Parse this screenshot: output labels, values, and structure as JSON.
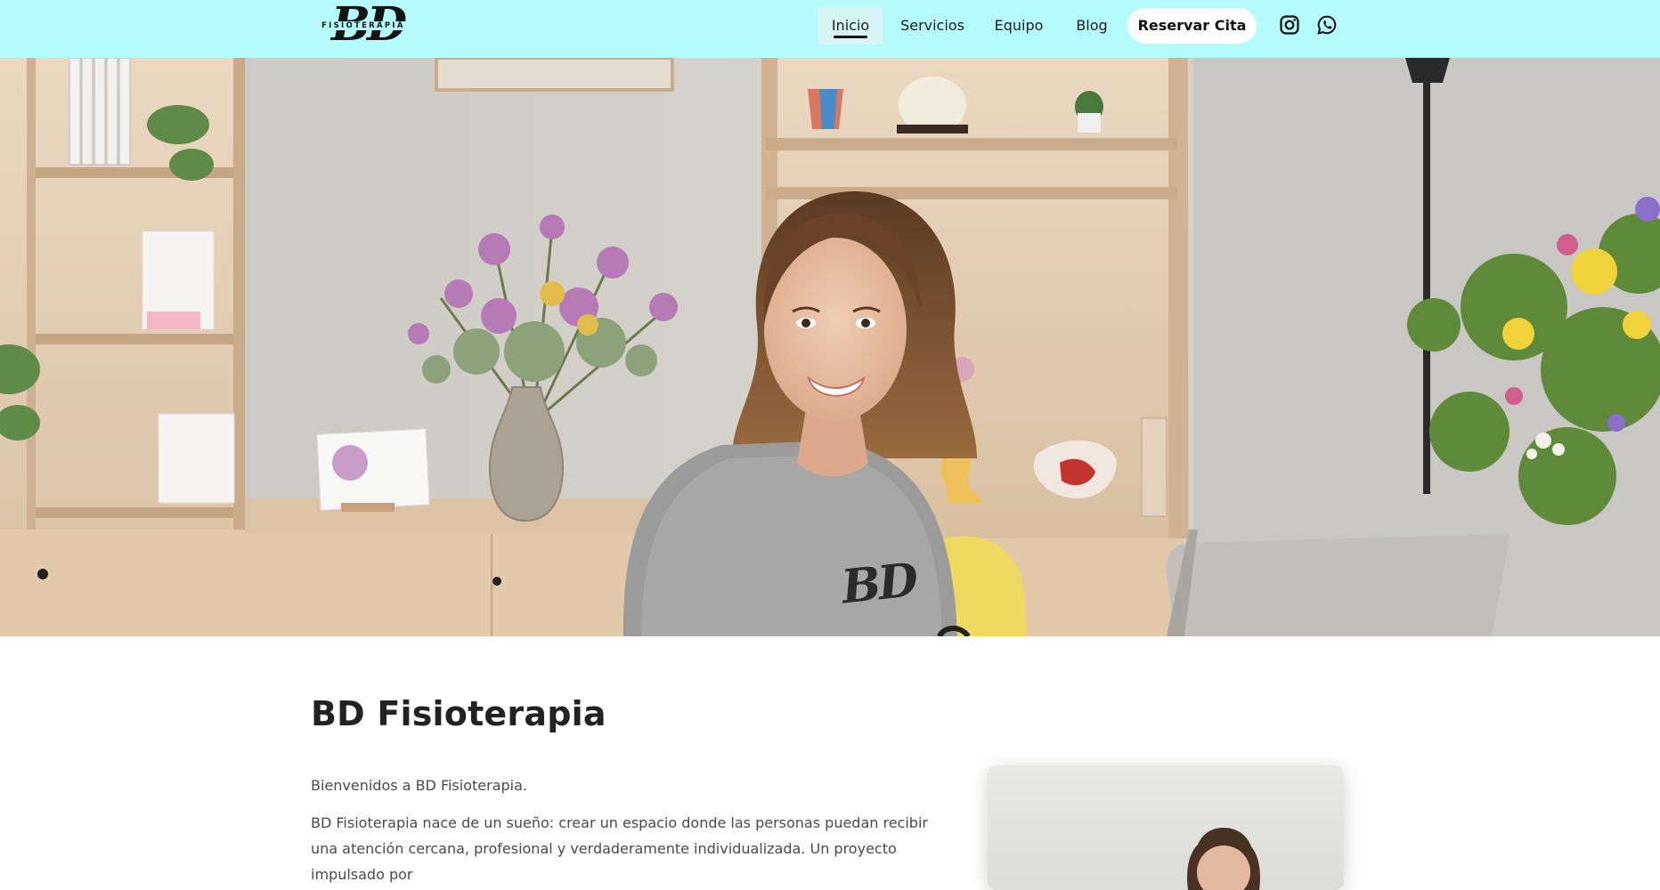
{
  "logo": {
    "mark": "BD",
    "text": "FISIOTERAPIA"
  },
  "nav": {
    "items": [
      {
        "label": "Inicio",
        "active": true
      },
      {
        "label": "Servicios",
        "active": false
      },
      {
        "label": "Equipo",
        "active": false
      },
      {
        "label": "Blog",
        "active": false
      }
    ],
    "cta_label": "Reservar Cita",
    "social": [
      "instagram-icon",
      "whatsapp-icon"
    ]
  },
  "hero": {
    "image": "physiotherapist smiling at desk in clinic"
  },
  "main": {
    "title": "BD Fisioterapia",
    "intro": "Bienvenidos a BD Fisioterapia.",
    "body": "BD Fisioterapia nace de un sueño: crear un espacio donde las personas puedan recibir una atención cercana, profesional y verdaderamente individualizada. Un proyecto impulsado por"
  },
  "colors": {
    "header_bg": "#b5fbfd",
    "title": "#222222",
    "text": "#4a4a4a",
    "cta_bg": "#ffffff"
  }
}
